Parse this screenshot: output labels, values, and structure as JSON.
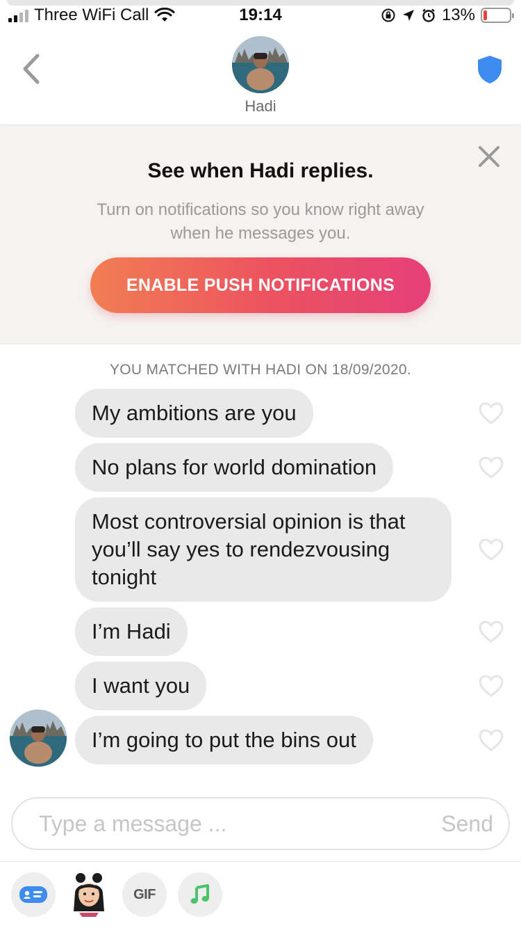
{
  "status_bar": {
    "carrier": "Three WiFi Call",
    "time": "19:14",
    "battery": "13%",
    "battery_level": 0.13
  },
  "header": {
    "match_name": "Hadi",
    "back_icon": "chevron-left-icon",
    "safety_icon": "shield-icon"
  },
  "notification_prompt": {
    "title": "See when Hadi replies.",
    "body": "Turn on notifications so you know right away when he messages you.",
    "button_label": "ENABLE PUSH NOTIFICATIONS",
    "colors": {
      "gradient_start": "#f27d53",
      "gradient_end": "#e6407a"
    }
  },
  "conversation": {
    "match_notice": "YOU MATCHED WITH HADI ON 18/09/2020.",
    "messages": [
      {
        "text": "My ambitions are you"
      },
      {
        "text": "No plans for world domination"
      },
      {
        "text": "Most controversial opinion is that you’ll say yes to rendezvousing tonight"
      },
      {
        "text": "I’m Hadi"
      },
      {
        "text": "I want you"
      },
      {
        "text": "I’m going to put the bins out"
      }
    ]
  },
  "composer": {
    "placeholder": "Type a message ...",
    "send_label": "Send"
  },
  "toolbar": {
    "gif_label": "GIF",
    "items": [
      "contact-card-icon",
      "bitmoji-icon",
      "gif-icon",
      "music-note-icon"
    ]
  }
}
